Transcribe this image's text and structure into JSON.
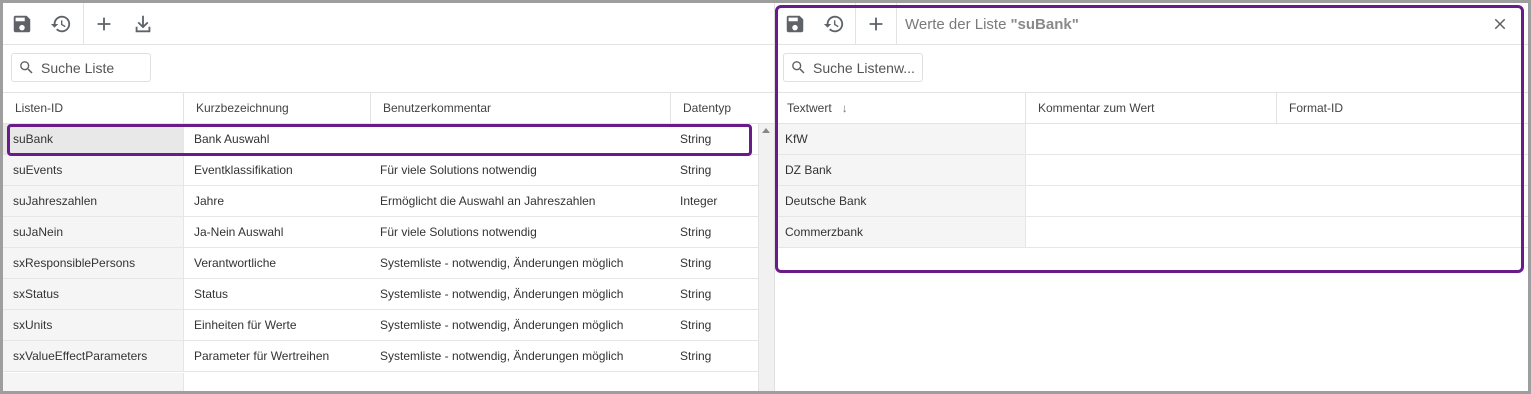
{
  "left": {
    "toolbar": {
      "save_icon": "save-icon",
      "history_icon": "restore-icon",
      "add_icon": "plus-icon",
      "download_icon": "download-icon"
    },
    "search": {
      "placeholder": "Suche Liste"
    },
    "columns": [
      "Listen-ID",
      "Kurzbezeichnung",
      "Benutzerkommentar",
      "Datentyp"
    ],
    "rows": [
      {
        "id": "suBank",
        "short": "Bank Auswahl",
        "comment": "",
        "type": "String",
        "selected": true
      },
      {
        "id": "suEvents",
        "short": "Eventklassifikation",
        "comment": "Für viele Solutions notwendig",
        "type": "String"
      },
      {
        "id": "suJahreszahlen",
        "short": "Jahre",
        "comment": "Ermöglicht die Auswahl an Jahreszahlen",
        "type": "Integer"
      },
      {
        "id": "suJaNein",
        "short": "Ja-Nein Auswahl",
        "comment": "Für viele Solutions notwendig",
        "type": "String"
      },
      {
        "id": "sxResponsiblePersons",
        "short": "Verantwortliche",
        "comment": "Systemliste - notwendig, Änderungen möglich",
        "type": "String"
      },
      {
        "id": "sxStatus",
        "short": "Status",
        "comment": "Systemliste - notwendig, Änderungen möglich",
        "type": "String"
      },
      {
        "id": "sxUnits",
        "short": "Einheiten für Werte",
        "comment": "Systemliste - notwendig, Änderungen möglich",
        "type": "String"
      },
      {
        "id": "sxValueEffectParameters",
        "short": "Parameter für Wertreihen",
        "comment": "Systemliste - notwendig, Änderungen möglich",
        "type": "String"
      }
    ]
  },
  "right": {
    "title_prefix": "Werte der Liste",
    "title_name": "\"suBank\"",
    "search": {
      "placeholder": "Suche Listenw..."
    },
    "columns": [
      "Textwert",
      "Kommentar zum Wert",
      "Format-ID"
    ],
    "sort_indicator": "↓",
    "rows": [
      {
        "text": "KfW",
        "comment": "",
        "format": ""
      },
      {
        "text": "DZ Bank",
        "comment": "",
        "format": ""
      },
      {
        "text": "Deutsche Bank",
        "comment": "",
        "format": ""
      },
      {
        "text": "Commerzbank",
        "comment": "",
        "format": ""
      }
    ]
  },
  "colors": {
    "highlight": "#6a1b8a",
    "first_col_bg": "#f5f5f5"
  }
}
